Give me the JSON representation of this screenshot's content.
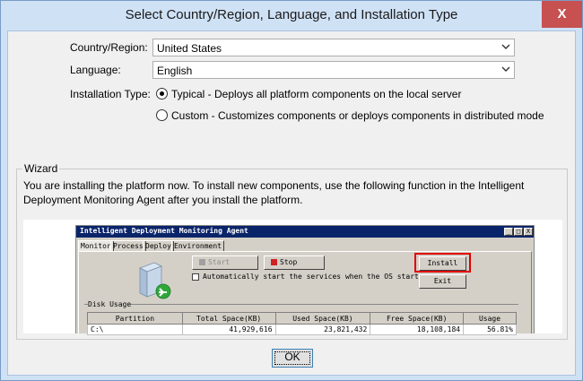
{
  "window": {
    "title": "Select Country/Region, Language, and Installation Type",
    "close_glyph": "X"
  },
  "form": {
    "country_label": "Country/Region:",
    "country_value": "United States",
    "language_label": "Language:",
    "language_value": "English",
    "install_type_label": "Installation Type:",
    "options": [
      {
        "label": "Typical - Deploys all platform components on the local server",
        "selected": true
      },
      {
        "label": "Custom - Customizes components or deploys components in distributed mode",
        "selected": false
      }
    ]
  },
  "wizard": {
    "legend": "Wizard",
    "text": "You are installing the platform now. To install new components, use the following function in the Intelligent Deployment Monitoring Agent after you install the platform."
  },
  "agent_preview": {
    "title": "Intelligent Deployment Monitoring Agent",
    "caption_buttons": [
      "_",
      "□",
      "X"
    ],
    "tabs": [
      "Monitor",
      "Process",
      "Deploy",
      "Environment"
    ],
    "start_label": "Start",
    "stop_label": "Stop",
    "install_label": "Install",
    "exit_label": "Exit",
    "autostart_label": "Automatically start the services when the OS starts.",
    "disk_usage_label": "Disk Usage",
    "table": {
      "headers": [
        "Partition",
        "Total Space(KB)",
        "Used Space(KB)",
        "Free Space(KB)",
        "Usage"
      ],
      "rows": [
        [
          "C:\\",
          "41,929,616",
          "23,821,432",
          "18,108,184",
          "56.81%"
        ]
      ]
    },
    "highlight_color": "#e00000"
  },
  "buttons": {
    "ok_label": "OK"
  }
}
